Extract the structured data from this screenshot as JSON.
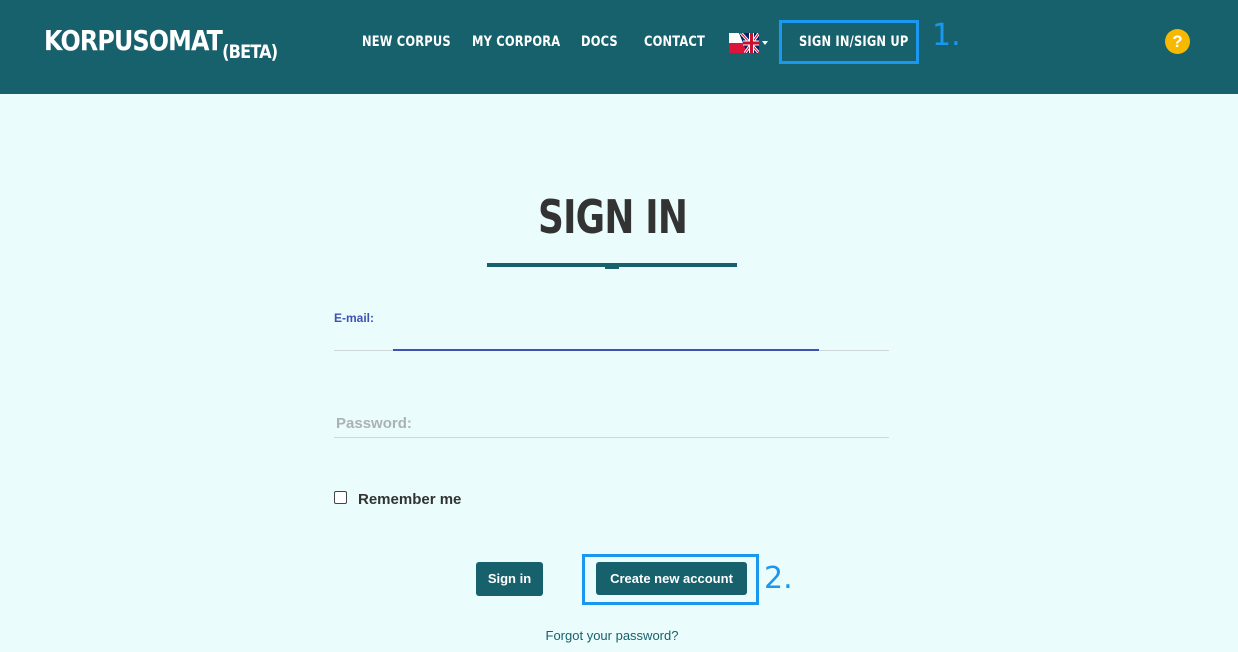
{
  "header": {
    "logo": "KORPUSOMAT",
    "logo_suffix": "(BETA)",
    "nav": {
      "new_corpus": "NEW CORPUS",
      "my_corpora": "MY CORPORA",
      "docs": "DOCS",
      "contact": "CONTACT",
      "sign_in_up": "SIGN IN/SIGN UP"
    },
    "language_icon": "polish-uk-flag-icon",
    "help_label": "?"
  },
  "annotations": {
    "first": "1.",
    "second": "2."
  },
  "form": {
    "title": "SIGN IN",
    "email_label": "E-mail:",
    "email_value": "",
    "password_placeholder": "Password:",
    "remember_label": "Remember me",
    "sign_in_button": "Sign in",
    "create_account_button": "Create new account",
    "forgot_link": "Forgot your password?"
  },
  "colors": {
    "header_bg": "#17616c",
    "page_bg": "#eafcfc",
    "accent_blue": "#3f51b5",
    "highlight": "#1a97ee",
    "help_yellow": "#f7b800"
  }
}
